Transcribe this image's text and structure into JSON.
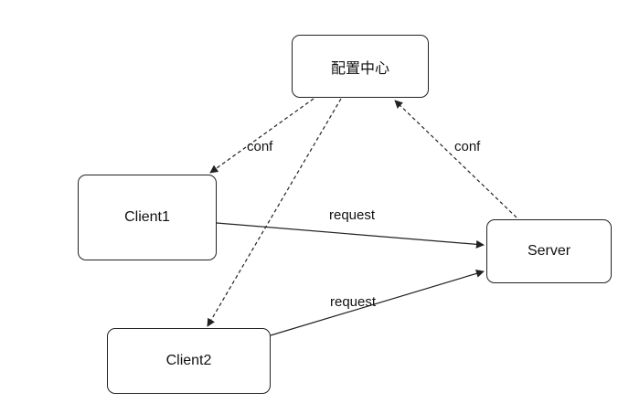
{
  "nodes": {
    "config_center": "配置中心",
    "client1": "Client1",
    "client2": "Client2",
    "server": "Server"
  },
  "edges": [
    {
      "from": "config_center",
      "to": "client1",
      "label": "conf",
      "style": "dashed"
    },
    {
      "from": "config_center",
      "to": "client2",
      "label": "",
      "style": "dashed"
    },
    {
      "from": "server",
      "to": "config_center",
      "label": "conf",
      "style": "dashed"
    },
    {
      "from": "client1",
      "to": "server",
      "label": "request",
      "style": "solid"
    },
    {
      "from": "client2",
      "to": "server",
      "label": "request",
      "style": "solid"
    }
  ],
  "colors": {
    "line": "#222222",
    "background": "#ffffff"
  }
}
